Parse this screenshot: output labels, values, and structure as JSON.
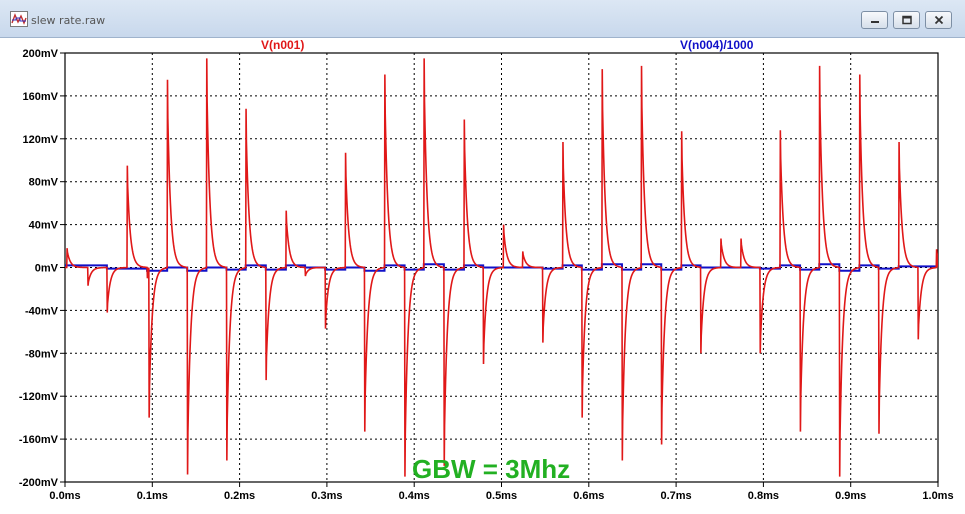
{
  "window": {
    "title": "slew rate.raw",
    "icon": "waveform-viewer-icon",
    "controls": {
      "minimize": "minimize-icon",
      "restore": "restore-icon",
      "close": "close-icon"
    }
  },
  "colors": {
    "trace1": "#e01818",
    "trace2": "#1010c8",
    "annotation": "#22b022",
    "grid": "#000000"
  },
  "chart_data": {
    "type": "line",
    "series": [
      {
        "name": "V(n001)"
      },
      {
        "name": "V(n004)/1000"
      }
    ],
    "x_ticks": [
      "0.0ms",
      "0.1ms",
      "0.2ms",
      "0.3ms",
      "0.4ms",
      "0.5ms",
      "0.6ms",
      "0.7ms",
      "0.8ms",
      "0.9ms",
      "1.0ms"
    ],
    "y_ticks": [
      "200mV",
      "160mV",
      "120mV",
      "80mV",
      "40mV",
      "0mV",
      "-40mV",
      "-80mV",
      "-120mV",
      "-160mV",
      "-200mV"
    ],
    "xlim": [
      0,
      1.0
    ],
    "ylim": [
      -200,
      200
    ],
    "x_unit": "ms",
    "y_unit": "mV",
    "grid": true,
    "annotation": "GBW = 3Mhz",
    "spikes": [
      {
        "t": 0.002,
        "v": 18
      },
      {
        "t": 0.026,
        "v": -17
      },
      {
        "t": 0.048,
        "v": -42
      },
      {
        "t": 0.071,
        "v": 95
      },
      {
        "t": 0.094,
        "v": -10
      },
      {
        "t": 0.096,
        "v": -140
      },
      {
        "t": 0.117,
        "v": 175
      },
      {
        "t": 0.14,
        "v": -193
      },
      {
        "t": 0.162,
        "v": 195
      },
      {
        "t": 0.185,
        "v": -180
      },
      {
        "t": 0.207,
        "v": 148
      },
      {
        "t": 0.23,
        "v": -105
      },
      {
        "t": 0.253,
        "v": 53
      },
      {
        "t": 0.275,
        "v": -8
      },
      {
        "t": 0.298,
        "v": -57
      },
      {
        "t": 0.321,
        "v": 107
      },
      {
        "t": 0.343,
        "v": -153
      },
      {
        "t": 0.366,
        "v": 180
      },
      {
        "t": 0.389,
        "v": -195
      },
      {
        "t": 0.411,
        "v": 195
      },
      {
        "t": 0.434,
        "v": -185
      },
      {
        "t": 0.457,
        "v": 138
      },
      {
        "t": 0.479,
        "v": -90
      },
      {
        "t": 0.502,
        "v": 40
      },
      {
        "t": 0.524,
        "v": 15
      },
      {
        "t": 0.547,
        "v": -70
      },
      {
        "t": 0.57,
        "v": 117
      },
      {
        "t": 0.592,
        "v": -140
      },
      {
        "t": 0.615,
        "v": 185
      },
      {
        "t": 0.638,
        "v": -180
      },
      {
        "t": 0.66,
        "v": 188
      },
      {
        "t": 0.683,
        "v": -165
      },
      {
        "t": 0.706,
        "v": 127
      },
      {
        "t": 0.728,
        "v": -80
      },
      {
        "t": 0.751,
        "v": 27
      },
      {
        "t": 0.774,
        "v": 27
      },
      {
        "t": 0.796,
        "v": -80
      },
      {
        "t": 0.819,
        "v": 128
      },
      {
        "t": 0.842,
        "v": -153
      },
      {
        "t": 0.864,
        "v": 188
      },
      {
        "t": 0.887,
        "v": -195
      },
      {
        "t": 0.91,
        "v": 180
      },
      {
        "t": 0.932,
        "v": -155
      },
      {
        "t": 0.955,
        "v": 117
      },
      {
        "t": 0.977,
        "v": -67
      },
      {
        "t": 0.998,
        "v": 17
      }
    ],
    "steps": [
      {
        "t": 0.0,
        "v": 2
      },
      {
        "t": 0.048,
        "v": -1
      },
      {
        "t": 0.094,
        "v": -3
      },
      {
        "t": 0.117,
        "v": 0
      },
      {
        "t": 0.14,
        "v": -3
      },
      {
        "t": 0.162,
        "v": 0
      },
      {
        "t": 0.185,
        "v": -2
      },
      {
        "t": 0.207,
        "v": 2
      },
      {
        "t": 0.23,
        "v": -2
      },
      {
        "t": 0.253,
        "v": 2
      },
      {
        "t": 0.275,
        "v": 0
      },
      {
        "t": 0.298,
        "v": -2
      },
      {
        "t": 0.321,
        "v": 0
      },
      {
        "t": 0.343,
        "v": -3
      },
      {
        "t": 0.366,
        "v": 2
      },
      {
        "t": 0.389,
        "v": -2
      },
      {
        "t": 0.411,
        "v": 3
      },
      {
        "t": 0.434,
        "v": -2
      },
      {
        "t": 0.457,
        "v": 2
      },
      {
        "t": 0.479,
        "v": 0
      },
      {
        "t": 0.547,
        "v": -1
      },
      {
        "t": 0.57,
        "v": 2
      },
      {
        "t": 0.592,
        "v": -2
      },
      {
        "t": 0.615,
        "v": 3
      },
      {
        "t": 0.638,
        "v": -2
      },
      {
        "t": 0.66,
        "v": 3
      },
      {
        "t": 0.683,
        "v": -2
      },
      {
        "t": 0.706,
        "v": 2
      },
      {
        "t": 0.728,
        "v": 0
      },
      {
        "t": 0.796,
        "v": -1
      },
      {
        "t": 0.819,
        "v": 2
      },
      {
        "t": 0.842,
        "v": -2
      },
      {
        "t": 0.864,
        "v": 3
      },
      {
        "t": 0.887,
        "v": -3
      },
      {
        "t": 0.91,
        "v": 2
      },
      {
        "t": 0.932,
        "v": -1
      },
      {
        "t": 0.955,
        "v": 1
      },
      {
        "t": 1.0,
        "v": 0
      }
    ]
  }
}
